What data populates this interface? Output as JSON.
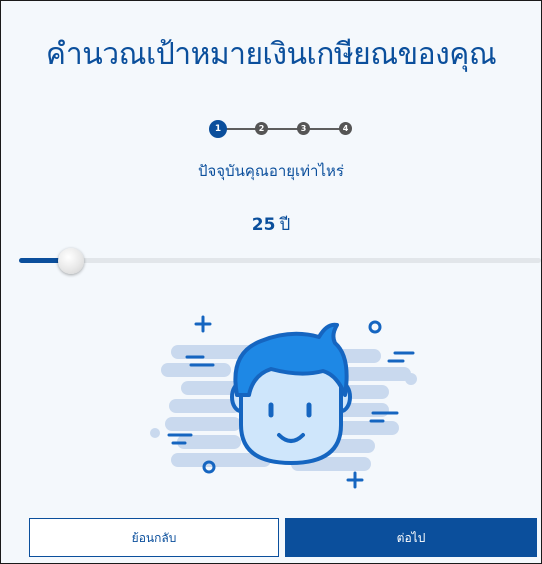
{
  "title": "คำนวณเป้าหมายเงินเกษียณของคุณ",
  "steps": {
    "items": [
      "1",
      "2",
      "3",
      "4"
    ],
    "current": 1
  },
  "question": "ปัจจุบันคุณอายุเท่าไหร่",
  "age": {
    "value": "25",
    "unit": "ปี"
  },
  "slider": {
    "value": 25,
    "fraction": 0.1
  },
  "buttons": {
    "back_label": "ย้อนกลับ",
    "next_label": "ต่อไป"
  },
  "colors": {
    "primary": "#0b4f9c",
    "face_fill": "#cfe6fb",
    "accent": "#1565c0",
    "smoke": "#c9d9ee"
  }
}
